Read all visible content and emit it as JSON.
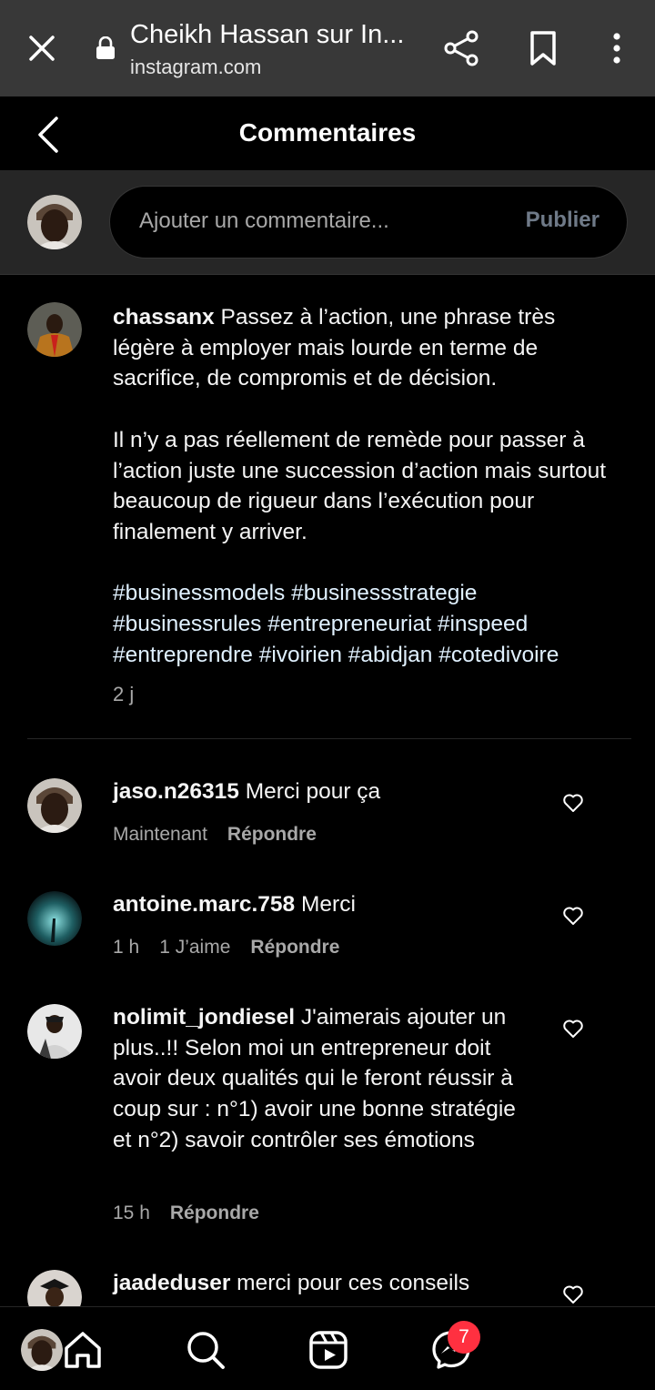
{
  "browser": {
    "title": "Cheikh Hassan sur In...",
    "domain": "instagram.com"
  },
  "header": {
    "title": "Commentaires"
  },
  "compose": {
    "placeholder": "Ajouter un commentaire...",
    "publish_label": "Publier"
  },
  "caption": {
    "username": "chassanx",
    "paragraph1": " Passez à l’action, une phrase très légère à employer mais lourde en terme de sacrifice, de compromis et de décision.",
    "paragraph2": "Il n’y a pas réellement de remède pour passer à l’action juste une succession d’action mais surtout beaucoup de rigueur dans l’exécution pour finalement y arriver.",
    "hashtags": "#businessmodels #businessstrategie #businessrules #entrepreneuriat #inspeed #entreprendre #ivoirien #abidjan #cotedivoire",
    "time": "2 j"
  },
  "comments": [
    {
      "username": "jaso.n26315",
      "text": " Merci pour ça",
      "time": "Maintenant",
      "likes": "",
      "reply": "Répondre"
    },
    {
      "username": "antoine.marc.758",
      "text": " Merci",
      "time": "1 h",
      "likes": "1 J’aime",
      "reply": "Répondre"
    },
    {
      "username": "nolimit_jondiesel",
      "text": " J'aimerais ajouter un plus..!! Selon moi un entrepreneur doit avoir deux qualités qui le feront réussir à coup sur : n°1) avoir une bonne stratégie et n°2) savoir contrôler ses émotions",
      "time": "15 h",
      "likes": "",
      "reply": "Répondre"
    },
    {
      "username": "jaadeduser",
      "text": " merci pour ces conseils",
      "time": "",
      "likes": "",
      "reply": ""
    }
  ],
  "bottom_nav": {
    "icons": [
      "home-icon",
      "search-icon",
      "reels-icon",
      "messenger-icon",
      "profile-avatar"
    ],
    "messages_badge": "7"
  },
  "colors": {
    "browser_bar": "#383838",
    "compose_bg": "#262626",
    "badge": "#ff3040",
    "publish_disabled": "#6f7a88",
    "hashtag": "#e0f1ff"
  }
}
